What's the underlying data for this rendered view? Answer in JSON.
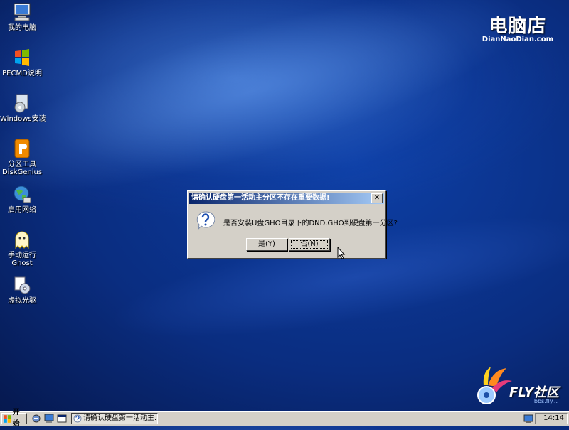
{
  "desktop": {
    "icons": [
      {
        "label": "我的电脑",
        "label2": ""
      },
      {
        "label": "PECMD说明",
        "label2": ""
      },
      {
        "label": "Windows安装",
        "label2": ""
      },
      {
        "label": "分区工具",
        "label2": "DiskGenius"
      },
      {
        "label": "启用网络",
        "label2": ""
      },
      {
        "label": "手动运行",
        "label2": "Ghost"
      },
      {
        "label": "虚拟光驱",
        "label2": ""
      }
    ]
  },
  "brand": {
    "name": "电脑店",
    "domain": "DianNaoDian.com"
  },
  "watermark": {
    "text": "FLY社区",
    "sub": "bbs.fly..."
  },
  "dialog": {
    "title": "请确认硬盘第一活动主分区不存在重要数据!",
    "close_label": "✕",
    "message": "是否安装U盘GHO目录下的DND.GHO到硬盘第一分区?",
    "yes_label": "是(Y)",
    "no_label": "否(N)"
  },
  "taskbar": {
    "start_label": "开始",
    "task_label": "请确认硬盘第一活动主...",
    "clock": "14:14"
  },
  "colors": {
    "desktop": "#0a2d80",
    "titlebar_start": "#08246b",
    "titlebar_end": "#a5cbf7",
    "face": "#d4d0c8"
  }
}
